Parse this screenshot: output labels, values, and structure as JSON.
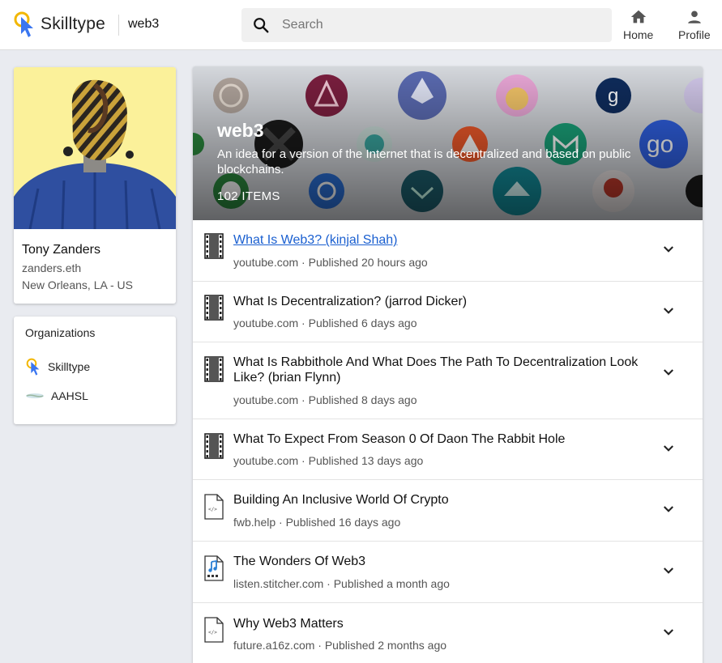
{
  "header": {
    "brand": "Skilltype",
    "topic": "web3",
    "search_placeholder": "Search",
    "nav": [
      {
        "label": "Home",
        "icon": "home-icon"
      },
      {
        "label": "Profile",
        "icon": "person-icon"
      }
    ]
  },
  "profile": {
    "name": "Tony Zanders",
    "handle": "zanders.eth",
    "location": "New Orleans, LA - US"
  },
  "organizations": {
    "title": "Organizations",
    "items": [
      {
        "label": "Skilltype",
        "icon": "skilltype-logo-icon"
      },
      {
        "label": "AAHSL",
        "icon": "aahsl-logo-icon"
      }
    ]
  },
  "collection": {
    "title": "web3",
    "description": "An idea for a version of the Internet that is decentralized and based on public blockchains.",
    "count": "102 ITEMS"
  },
  "items": [
    {
      "title": "What Is Web3? (kinjal Shah)",
      "meta": "youtube.com · Published 20 hours ago",
      "type": "video-icon"
    },
    {
      "title": "What Is Decentralization? (jarrod Dicker)",
      "meta": "youtube.com · Published 6 days ago",
      "type": "video-icon"
    },
    {
      "title": "What Is Rabbithole And What Does The Path To Decentralization Look Like? (brian Flynn)",
      "meta": "youtube.com · Published 8 days ago",
      "type": "video-icon"
    },
    {
      "title": "What To Expect From Season 0 Of Daon The Rabbit Hole",
      "meta": "youtube.com · Published 13 days ago",
      "type": "video-icon"
    },
    {
      "title": "Building An Inclusive World Of Crypto",
      "meta": "fwb.help · Published 16 days ago",
      "type": "code-file-icon"
    },
    {
      "title": "The Wonders Of Web3",
      "meta": "listen.stitcher.com · Published a month ago",
      "type": "audio-file-icon"
    },
    {
      "title": "Why Web3 Matters",
      "meta": "future.a16z.com · Published 2 months ago",
      "type": "code-file-icon"
    }
  ],
  "colors": {
    "accent_link": "#1a5fd0",
    "avatar_bg": "#fbf19a",
    "page_bg": "#e9ebf0"
  }
}
